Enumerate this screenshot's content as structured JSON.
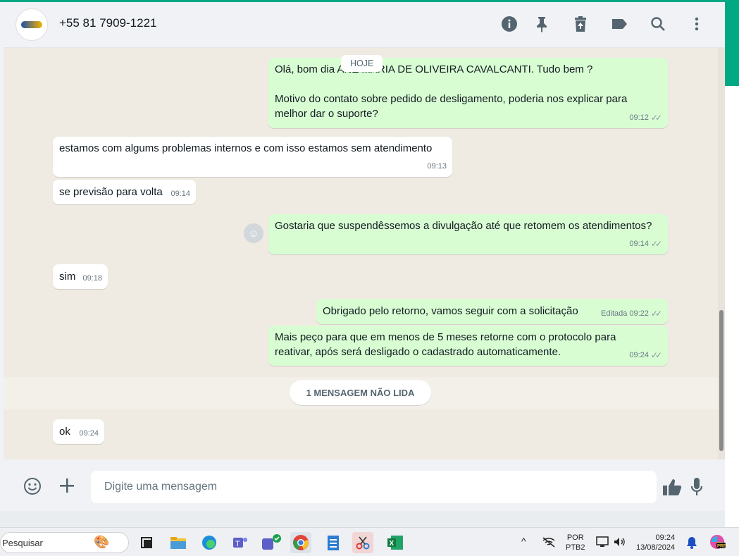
{
  "header": {
    "contact_name": "+55 81 7909-1221",
    "icons": [
      "info-icon",
      "pin-icon",
      "delete-icon",
      "label-icon",
      "search-icon",
      "more-vert-icon"
    ]
  },
  "date_pill": "HOJE",
  "messages": [
    {
      "dir": "out",
      "text": "Olá, bom dia ANE MARIA DE OLIVEIRA CAVALCANTI. Tudo bem ?",
      "text2": "Motivo do contato sobre pedido de desligamento, poderia nos explicar para",
      "text3": "melhor dar o suporte?",
      "time": "09:12"
    },
    {
      "dir": "in",
      "text": "estamos com algums problemas internos e com isso estamos sem atendimento",
      "time": "09:13"
    },
    {
      "dir": "in",
      "text": "se previsão para volta",
      "time": "09:14"
    },
    {
      "dir": "out",
      "text": "Gostaria que suspendêssemos a divulgação até que retomem os atendimentos?",
      "time": "09:14"
    },
    {
      "dir": "in",
      "text": "sim",
      "time": "09:18"
    },
    {
      "dir": "out",
      "text": "Obrigado pelo retorno, vamos seguir com a solicitação",
      "edited": "Editada",
      "time": "09:22"
    },
    {
      "dir": "out",
      "text": "Mais peço para que em menos de 5 meses retorne com o protocolo para",
      "text2": "reativar, após será desligado o cadastrado automaticamente.",
      "time": "09:24"
    },
    {
      "dir": "in",
      "text": "ok",
      "time": "09:24"
    }
  ],
  "unread_label": "1 MENSAGEM NÃO LIDA",
  "composer": {
    "placeholder": "Digite uma mensagem"
  },
  "taskbar": {
    "search_label": "Pesquisar",
    "lang_line1": "POR",
    "lang_line2": "PTB2",
    "time": "09:24",
    "date": "13/08/2024"
  },
  "colors": {
    "accent": "#00a884",
    "outgoing_bubble": "#d9fdd3",
    "chat_bg": "#efeae2"
  }
}
